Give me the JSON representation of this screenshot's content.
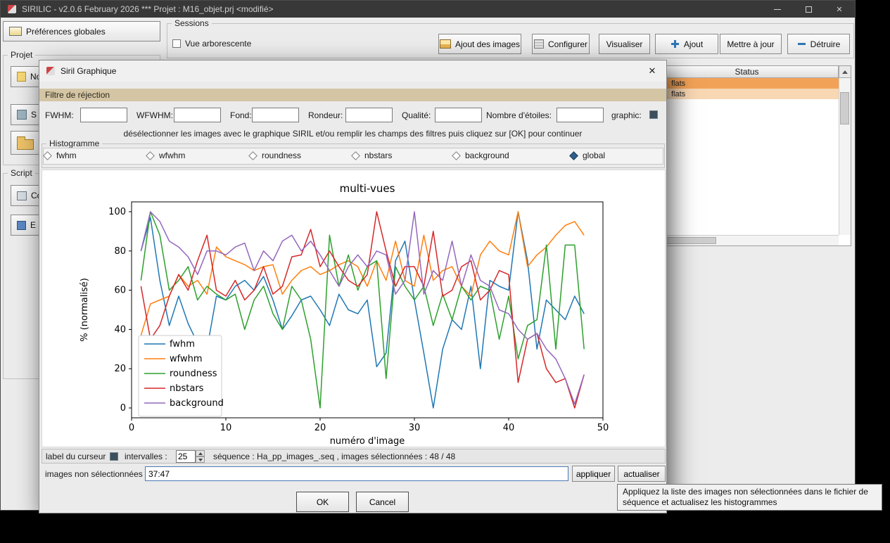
{
  "colors": {
    "filter_band": "#d4c5a4",
    "row_flat_dark": "#f2a257",
    "row_flat_light": "#f8d7b3",
    "checkbox_dark": "#3c4f5d",
    "radio_selected": "#2b5e8c",
    "accent_blue": "#2e75b6"
  },
  "main_window": {
    "title": "SIRILIC - v2.0.6 February 2026 *** Projet : M16_objet.prj <modifié>",
    "preferences_button": "Préférences globales",
    "project_label": "Projet",
    "script_label": "Script",
    "left_buttons": [
      "No",
      "S",
      "Co",
      "E"
    ],
    "sessions": {
      "label": "Sessions",
      "tree_checkbox": "Vue arborescente",
      "buttons": {
        "add_images": "Ajout des images",
        "configure": "Configurer",
        "visualize": "Visualiser",
        "add": "Ajout",
        "update": "Mettre à jour",
        "destroy": "Détruire"
      }
    },
    "table": {
      "header": "Status",
      "rows": [
        {
          "label": "flats"
        },
        {
          "label": "flats"
        }
      ]
    }
  },
  "dialog": {
    "title": "Siril Graphique",
    "filter_header": "Filtre de réjection",
    "filters": [
      "FWHM:",
      "WFWHM:",
      "Fond:",
      "Rondeur:",
      "Qualité:",
      "Nombre d'étoiles:"
    ],
    "graphic_label": "graphic:",
    "instruction": "désélectionner les images avec le graphique SIRIL et/ou remplir les champs des filtres puis cliquez sur [OK] pour continuer",
    "histogram": {
      "label": "Histogramme",
      "options": [
        "fwhm",
        "wfwhm",
        "roundness",
        "nbstars",
        "background",
        "global"
      ],
      "selected": "global"
    },
    "footer": {
      "cursor_label": "label du curseur",
      "intervals_label": "intervalles :",
      "intervals_value": "25",
      "sequence_text": "séquence : Ha_pp_images_.seq ,  images sélectionnées : 48 / 48",
      "unselected_label": "images non sélectionnées :",
      "unselected_value": "37:47",
      "apply_button": "appliquer",
      "refresh_button": "actualiser"
    },
    "tooltip": "Appliquez la liste des images non sélectionnées dans le fichier de séquence et actualisez les histogrammes",
    "ok_button": "OK",
    "cancel_button": "Cancel"
  },
  "chart_data": {
    "type": "line",
    "title": "multi-vues",
    "xlabel": "numéro d'image",
    "ylabel": "% (normalisé)",
    "xlim": [
      0,
      50
    ],
    "ylim": [
      0,
      100
    ],
    "xticks": [
      0,
      10,
      20,
      30,
      40,
      50
    ],
    "yticks": [
      0,
      20,
      40,
      60,
      80,
      100
    ],
    "grid": false,
    "legend_position": "lower left",
    "x": [
      1,
      2,
      3,
      4,
      5,
      6,
      7,
      8,
      9,
      10,
      11,
      12,
      13,
      14,
      15,
      16,
      17,
      18,
      19,
      20,
      21,
      22,
      23,
      24,
      25,
      26,
      27,
      28,
      29,
      30,
      31,
      32,
      33,
      34,
      35,
      36,
      37,
      38,
      39,
      40,
      41,
      42,
      43,
      44,
      45,
      46,
      47,
      48
    ],
    "series": [
      {
        "name": "fwhm",
        "color": "#1f77b4",
        "values": [
          80,
          97,
          65,
          42,
          57,
          43,
          33,
          30,
          57,
          55,
          62,
          65,
          60,
          67,
          55,
          40,
          47,
          55,
          57,
          50,
          42,
          58,
          50,
          48,
          55,
          21,
          28,
          75,
          85,
          55,
          28,
          0,
          30,
          45,
          40,
          62,
          20,
          65,
          62,
          60,
          100,
          75,
          30,
          55,
          50,
          45,
          57,
          48
        ]
      },
      {
        "name": "wfwhm",
        "color": "#ff7f0e",
        "values": [
          37,
          53,
          55,
          57,
          68,
          62,
          65,
          58,
          82,
          77,
          75,
          73,
          70,
          72,
          73,
          58,
          65,
          70,
          72,
          68,
          70,
          73,
          75,
          72,
          62,
          75,
          65,
          85,
          65,
          62,
          88,
          65,
          70,
          72,
          62,
          57,
          78,
          85,
          80,
          78,
          100,
          72,
          78,
          82,
          88,
          93,
          95,
          88
        ]
      },
      {
        "name": "roundness",
        "color": "#2ca02c",
        "values": [
          65,
          100,
          88,
          60,
          65,
          72,
          55,
          62,
          58,
          55,
          58,
          40,
          55,
          62,
          48,
          40,
          62,
          55,
          35,
          0,
          88,
          62,
          78,
          60,
          72,
          75,
          15,
          72,
          62,
          55,
          62,
          42,
          58,
          45,
          62,
          55,
          62,
          60,
          35,
          57,
          25,
          42,
          45,
          83,
          30,
          83,
          83,
          30
        ]
      },
      {
        "name": "nbstars",
        "color": "#d62728",
        "values": [
          62,
          35,
          42,
          57,
          68,
          60,
          75,
          88,
          60,
          57,
          65,
          55,
          60,
          72,
          58,
          62,
          77,
          78,
          91,
          72,
          80,
          72,
          65,
          62,
          68,
          100,
          80,
          62,
          72,
          72,
          62,
          90,
          57,
          60,
          72,
          75,
          55,
          60,
          70,
          68,
          13,
          35,
          38,
          20,
          13,
          15,
          0,
          17
        ]
      },
      {
        "name": "background",
        "color": "#9467bd",
        "values": [
          80,
          100,
          95,
          85,
          82,
          77,
          68,
          80,
          80,
          78,
          82,
          84,
          70,
          80,
          75,
          85,
          88,
          80,
          85,
          78,
          70,
          62,
          72,
          78,
          72,
          80,
          78,
          58,
          65,
          100,
          58,
          70,
          65,
          85,
          62,
          78,
          65,
          62,
          50,
          48,
          40,
          35,
          38,
          30,
          25,
          15,
          2,
          17
        ]
      }
    ]
  }
}
